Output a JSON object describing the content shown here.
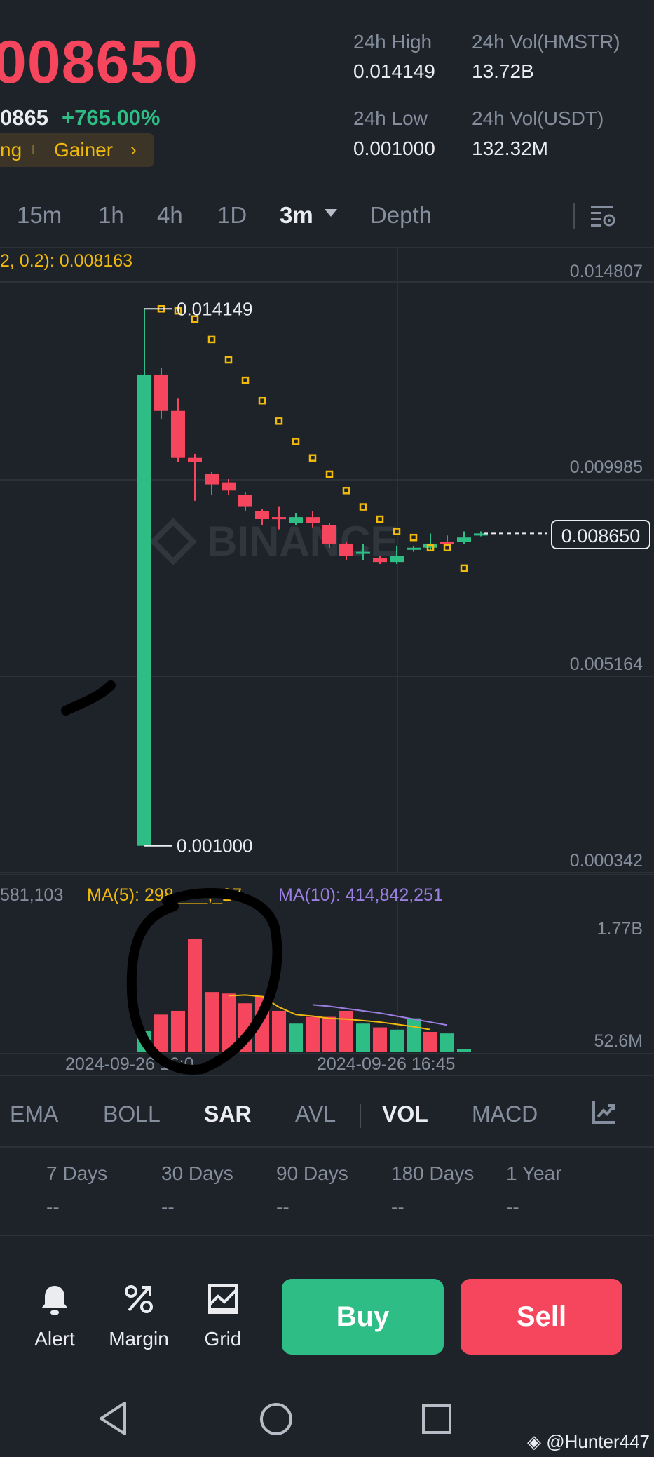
{
  "ticker": {
    "last_price": "008650",
    "prev_fragment": "0865",
    "change_pct": "+765.00%",
    "tags": [
      "ng",
      "Gainer"
    ],
    "chevron_icon": "chevron-right-icon"
  },
  "stats": {
    "high_label": "24h High",
    "high_value": "0.014149",
    "low_label": "24h Low",
    "low_value": "0.001000",
    "vol_base_label": "24h Vol(HMSTR)",
    "vol_base_value": "13.72B",
    "vol_quote_label": "24h Vol(USDT)",
    "vol_quote_value": "132.32M"
  },
  "timeframes": {
    "items": [
      "15m",
      "1h",
      "4h",
      "1D",
      "3m",
      "Depth"
    ],
    "active": "3m",
    "settings_icon": "chart-settings-icon"
  },
  "chart": {
    "indicator_text": "2, 0.2): 0.008163",
    "y_labels": [
      "0.014807",
      "0.009985",
      "0.005164",
      "0.000342"
    ],
    "max_label": "0.014149",
    "min_label": "0.001000",
    "current_price": "0.008650",
    "watermark": "BINANCE",
    "vol_y_labels": [
      "1.77B",
      "52.6M"
    ],
    "vol_label_left": "581,103",
    "ma5_label": "MA(5): 298,___,_27",
    "ma10_label": "MA(10): 414,842,251",
    "time_labels": [
      "2024-09-26 16:0",
      "2024-09-26 16:45"
    ]
  },
  "chart_data": {
    "type": "candlestick",
    "ylim": [
      0.000342,
      0.014807
    ],
    "candles": [
      {
        "o": 0.001,
        "h": 0.014149,
        "l": 0.001,
        "c": 0.01254,
        "color": "#2ebd85"
      },
      {
        "o": 0.01254,
        "h": 0.0127,
        "l": 0.01145,
        "c": 0.01165,
        "color": "#f6465d"
      },
      {
        "o": 0.01165,
        "h": 0.01195,
        "l": 0.0104,
        "c": 0.0105,
        "color": "#f6465d"
      },
      {
        "o": 0.0105,
        "h": 0.0106,
        "l": 0.00945,
        "c": 0.0104,
        "color": "#f6465d"
      },
      {
        "o": 0.0101,
        "h": 0.01015,
        "l": 0.0096,
        "c": 0.00985,
        "color": "#f6465d"
      },
      {
        "o": 0.0099,
        "h": 0.00998,
        "l": 0.0096,
        "c": 0.0097,
        "color": "#f6465d"
      },
      {
        "o": 0.0096,
        "h": 0.00965,
        "l": 0.0092,
        "c": 0.0093,
        "color": "#f6465d"
      },
      {
        "o": 0.0092,
        "h": 0.00925,
        "l": 0.00885,
        "c": 0.009,
        "color": "#f6465d"
      },
      {
        "o": 0.00905,
        "h": 0.0093,
        "l": 0.00875,
        "c": 0.009,
        "color": "#f6465d"
      },
      {
        "o": 0.0089,
        "h": 0.00915,
        "l": 0.00885,
        "c": 0.00905,
        "color": "#2ebd85"
      },
      {
        "o": 0.00905,
        "h": 0.0092,
        "l": 0.0088,
        "c": 0.0089,
        "color": "#f6465d"
      },
      {
        "o": 0.00885,
        "h": 0.0089,
        "l": 0.0083,
        "c": 0.0084,
        "color": "#f6465d"
      },
      {
        "o": 0.0084,
        "h": 0.00845,
        "l": 0.008,
        "c": 0.0081,
        "color": "#f6465d"
      },
      {
        "o": 0.00815,
        "h": 0.0084,
        "l": 0.008,
        "c": 0.0082,
        "color": "#2ebd85"
      },
      {
        "o": 0.00805,
        "h": 0.0081,
        "l": 0.0079,
        "c": 0.00795,
        "color": "#f6465d"
      },
      {
        "o": 0.00795,
        "h": 0.00835,
        "l": 0.0079,
        "c": 0.0081,
        "color": "#2ebd85"
      },
      {
        "o": 0.0083,
        "h": 0.00835,
        "l": 0.0082,
        "c": 0.00825,
        "color": "#2ebd85"
      },
      {
        "o": 0.0083,
        "h": 0.00865,
        "l": 0.00825,
        "c": 0.0084,
        "color": "#2ebd85"
      },
      {
        "o": 0.00845,
        "h": 0.0086,
        "l": 0.0084,
        "c": 0.00843,
        "color": "#f6465d"
      },
      {
        "o": 0.00845,
        "h": 0.0087,
        "l": 0.0084,
        "c": 0.00855,
        "color": "#2ebd85"
      },
      {
        "o": 0.0086,
        "h": 0.0087,
        "l": 0.00858,
        "c": 0.00865,
        "color": "#2ebd85"
      }
    ],
    "sar": [
      0.01415,
      0.0141,
      0.0139,
      0.0134,
      0.0129,
      0.0124,
      0.0119,
      0.0114,
      0.0109,
      0.0105,
      0.0101,
      0.0097,
      0.0093,
      0.009,
      0.0087,
      0.00855,
      0.0083,
      0.0083,
      0.0078
    ],
    "volume": {
      "values": [
        0.28,
        0.5,
        0.55,
        1.5,
        0.8,
        0.78,
        0.65,
        0.75,
        0.55,
        0.38,
        0.47,
        0.47,
        0.55,
        0.38,
        0.33,
        0.3,
        0.45,
        0.27,
        0.25,
        0.04
      ],
      "colors": [
        "#2ebd85",
        "#f6465d",
        "#f6465d",
        "#f6465d",
        "#f6465d",
        "#f6465d",
        "#f6465d",
        "#f6465d",
        "#f6465d",
        "#2ebd85",
        "#f6465d",
        "#f6465d",
        "#f6465d",
        "#2ebd85",
        "#f6465d",
        "#2ebd85",
        "#2ebd85",
        "#f6465d",
        "#2ebd85",
        "#2ebd85"
      ],
      "ma5": [
        null,
        null,
        null,
        null,
        0.75,
        0.76,
        0.74,
        0.6,
        0.5,
        0.48,
        0.45,
        0.44,
        0.42,
        0.4,
        0.37,
        0.34,
        0.3
      ],
      "ma10": [
        null,
        null,
        null,
        null,
        null,
        null,
        null,
        null,
        null,
        0.63,
        0.61,
        0.58,
        0.55,
        0.52,
        0.48,
        0.44,
        0.4,
        0.36
      ]
    }
  },
  "bottom_tabs": {
    "items": [
      "EMA",
      "BOLL",
      "SAR",
      "AVL",
      "VOL",
      "MACD"
    ],
    "active": [
      "SAR",
      "VOL"
    ],
    "more_icon": "chart-indicator-icon"
  },
  "performance": {
    "labels": [
      "7 Days",
      "30 Days",
      "90 Days",
      "180 Days",
      "1 Year"
    ],
    "values": [
      "--",
      "--",
      "--",
      "--",
      "--"
    ]
  },
  "actions": {
    "alert_label": "Alert",
    "alert_icon": "bell-icon",
    "margin_label": "Margin",
    "margin_icon": "percent-icon",
    "grid_label": "Grid",
    "grid_icon": "grid-icon",
    "buy_label": "Buy",
    "sell_label": "Sell",
    "buy_color": "#2ebd85",
    "sell_color": "#f6465d"
  },
  "navbar": {
    "back_icon": "back-triangle-icon",
    "home_icon": "home-circle-icon",
    "recents_icon": "recents-square-icon"
  },
  "credit": "@Hunter447"
}
